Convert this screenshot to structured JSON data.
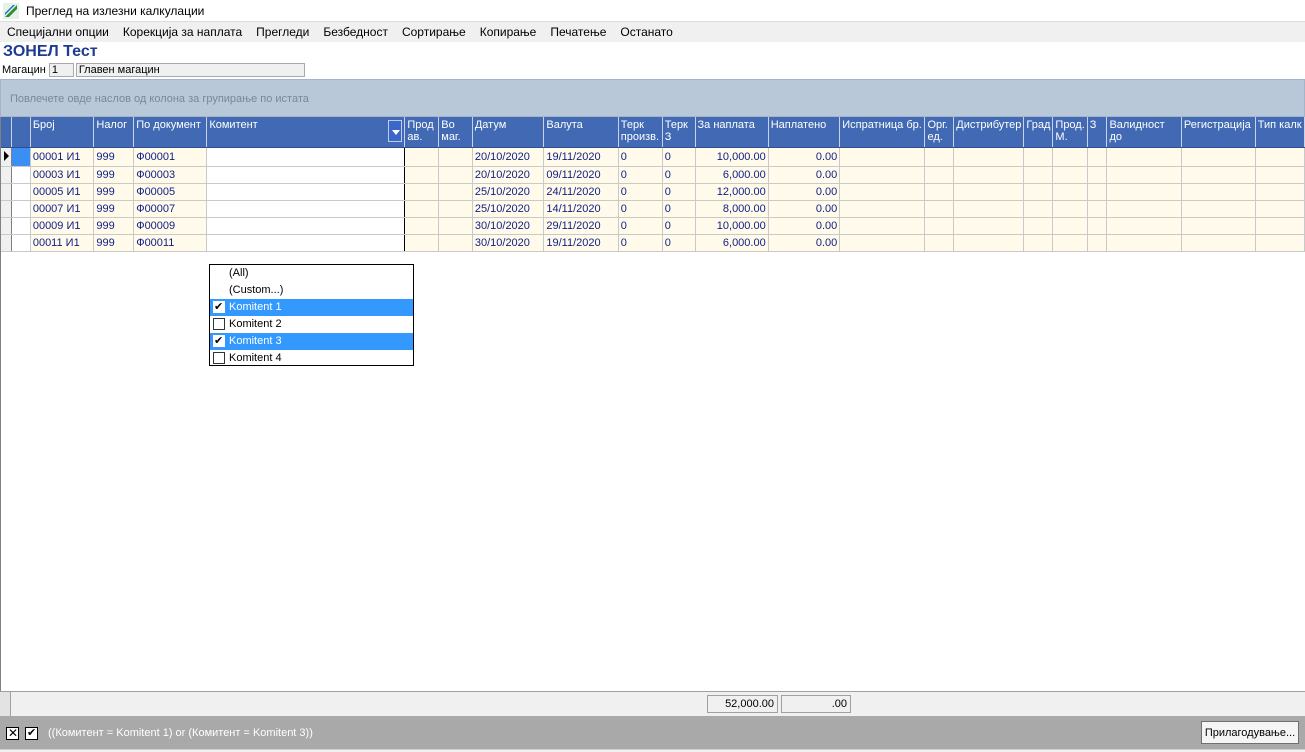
{
  "window": {
    "title": "Преглед на излезни калкулации"
  },
  "menu": [
    "Специјални опции",
    "Корекција за наплата",
    "Прегледи",
    "Безбедност",
    "Сортирање",
    "Копирање",
    "Печатење",
    "Останато"
  ],
  "company": "ЗОНЕЛ Тест",
  "warehouse": {
    "label": "Магацин",
    "code": "1",
    "name": "Главен магацин"
  },
  "group_panel": "Повлечете овде наслов од колона за групирање по истата",
  "columns": [
    "Број",
    "Налог",
    "По документ",
    "Комитент",
    "Прод ав.",
    "Во маг.",
    "Датум",
    "Валута",
    "Терк произв.",
    "Терк З",
    "За наплата",
    "Наплатено",
    "Испратница бр.",
    "Орг. ед.",
    "Дистрибутер",
    "Град",
    "Прод. М.",
    "З",
    "Валидност до",
    "Регистрација",
    "Тип калк"
  ],
  "rows": [
    [
      "00001  И1",
      "999",
      "Ф00001",
      "",
      "",
      "",
      "20/10/2020",
      "19/11/2020",
      "0",
      "0",
      "10,000.00",
      "0.00"
    ],
    [
      "00003  И1",
      "999",
      "Ф00003",
      "",
      "",
      "",
      "20/10/2020",
      "09/11/2020",
      "0",
      "0",
      "6,000.00",
      "0.00"
    ],
    [
      "00005  И1",
      "999",
      "Ф00005",
      "",
      "",
      "",
      "25/10/2020",
      "24/11/2020",
      "0",
      "0",
      "12,000.00",
      "0.00"
    ],
    [
      "00007  И1",
      "999",
      "Ф00007",
      "",
      "",
      "",
      "25/10/2020",
      "14/11/2020",
      "0",
      "0",
      "8,000.00",
      "0.00"
    ],
    [
      "00009  И1",
      "999",
      "Ф00009",
      "",
      "",
      "",
      "30/10/2020",
      "29/11/2020",
      "0",
      "0",
      "10,000.00",
      "0.00"
    ],
    [
      "00011  И1",
      "999",
      "Ф00011",
      "",
      "",
      "",
      "30/10/2020",
      "19/11/2020",
      "0",
      "0",
      "6,000.00",
      "0.00"
    ]
  ],
  "filter_dropdown": [
    {
      "label": "(All)",
      "checkbox": false,
      "checked": false,
      "highlighted": false
    },
    {
      "label": "(Custom...)",
      "checkbox": false,
      "checked": false,
      "highlighted": false
    },
    {
      "label": "Komitent 1",
      "checkbox": true,
      "checked": true,
      "highlighted": true
    },
    {
      "label": "Komitent 2",
      "checkbox": true,
      "checked": false,
      "highlighted": false
    },
    {
      "label": "Komitent 3",
      "checkbox": true,
      "checked": true,
      "highlighted": true
    },
    {
      "label": "Komitent 4",
      "checkbox": true,
      "checked": false,
      "highlighted": false
    }
  ],
  "totals": {
    "za_naplata": "52,000.00",
    "naplateno": ".00"
  },
  "filter_expression": "((Комитент = Komitent 1) or (Комитент = Komitent 3))",
  "customize_label": "Прилагодување...",
  "colors": {
    "header": "#4169b4",
    "row_bg": "#fffaea",
    "row_text": "#0d1f86",
    "group_panel": "#b9c8d9",
    "highlight": "#3399ff"
  }
}
